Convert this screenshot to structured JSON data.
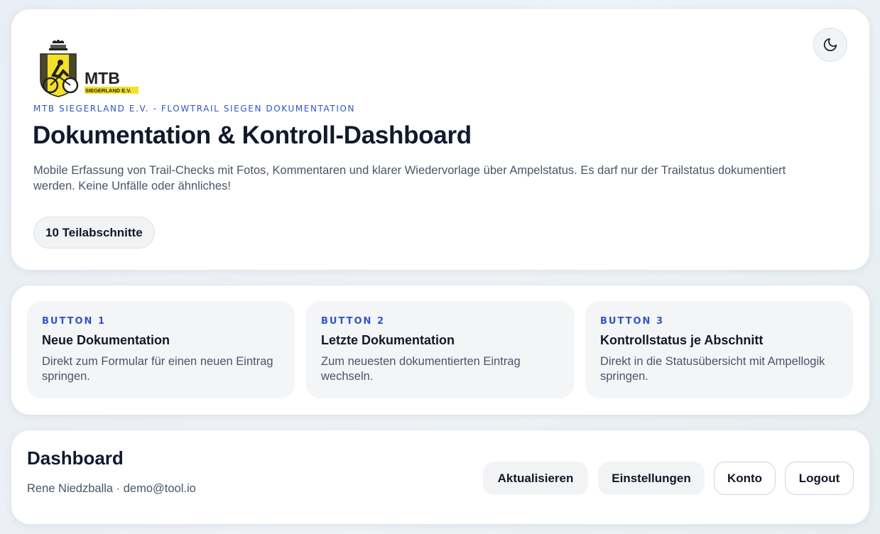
{
  "header": {
    "logo_text": "MTB",
    "logo_subtext": "SIEGERLAND E.V.",
    "eyebrow": "MTB SIEGERLAND E.V. - FLOWTRAIL SIEGEN DOKUMENTATION",
    "title": "Dokumentation & Kontroll-Dashboard",
    "description": "Mobile Erfassung von Trail-Checks mit Fotos, Kommentaren und klarer Wiedervorlage über Ampelstatus. Es darf nur der Trailstatus dokumentiert werden. Keine Unfälle oder ähnliches!",
    "sections_pill": "10 Teilabschnitte",
    "theme_toggle_icon": "moon-icon"
  },
  "quick_actions": [
    {
      "kicker": "BUTTON 1",
      "title": "Neue Dokumentation",
      "description": "Direkt zum Formular für einen neuen Eintrag springen."
    },
    {
      "kicker": "BUTTON 2",
      "title": "Letzte Dokumentation",
      "description": "Zum neuesten dokumentierten Eintrag wechseln."
    },
    {
      "kicker": "BUTTON 3",
      "title": "Kontrollstatus je Abschnitt",
      "description": "Direkt in die Statusübersicht mit Ampellogik springen."
    }
  ],
  "dashboard": {
    "title": "Dashboard",
    "user": "Rene Niedzballa · demo@tool.io",
    "buttons": {
      "refresh": "Aktualisieren",
      "settings": "Einstellungen",
      "account": "Konto",
      "logout": "Logout"
    }
  },
  "colors": {
    "accent": "#3056c8",
    "logo_yellow": "#f4e02a",
    "text_dark": "#101a2c",
    "text_muted": "#4a5568"
  }
}
